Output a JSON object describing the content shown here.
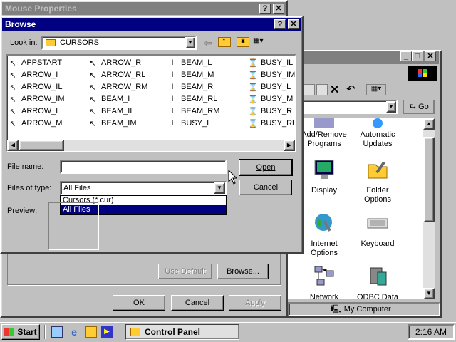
{
  "mouse_props": {
    "title": "Mouse Properties",
    "use_default_label": "Use Default",
    "browse_label": "Browse...",
    "ok_label": "OK",
    "cancel_label": "Cancel",
    "apply_label": "Apply"
  },
  "browse": {
    "title": "Browse",
    "look_in_label": "Look in:",
    "look_in_value": "CURSORS",
    "files": [
      [
        "APPSTART",
        "ARROW_I",
        "ARROW_IL",
        "ARROW_IM",
        "ARROW_L",
        "ARROW_M"
      ],
      [
        "ARROW_R",
        "ARROW_RL",
        "ARROW_RM",
        "BEAM_I",
        "BEAM_IL",
        "BEAM_IM"
      ],
      [
        "BEAM_L",
        "BEAM_M",
        "BEAM_R",
        "BEAM_RL",
        "BEAM_RM",
        "BUSY_I"
      ],
      [
        "BUSY_IL",
        "BUSY_IM",
        "BUSY_L",
        "BUSY_M",
        "BUSY_R",
        "BUSY_RL"
      ]
    ],
    "file_name_label": "File name:",
    "file_name_value": "",
    "files_of_type_label": "Files of type:",
    "files_of_type_value": "All Files",
    "type_options": [
      "Cursors (*.cur)",
      "All Files"
    ],
    "preview_label": "Preview:",
    "open_label": "Open",
    "cancel_label": "Cancel"
  },
  "control_panel": {
    "go_label": "Go",
    "items": [
      {
        "label": "Add/Remove Programs",
        "icon": "add-remove-programs-icon"
      },
      {
        "label": "Automatic Updates",
        "icon": "automatic-updates-icon"
      },
      {
        "label": "Display",
        "icon": "display-icon"
      },
      {
        "label": "Folder Options",
        "icon": "folder-options-icon"
      },
      {
        "label": "Internet Options",
        "icon": "internet-options-icon"
      },
      {
        "label": "Keyboard",
        "icon": "keyboard-icon"
      },
      {
        "label": "Network",
        "icon": "network-icon"
      },
      {
        "label": "ODBC Data",
        "icon": "odbc-data-icon"
      }
    ],
    "status": "My Computer"
  },
  "taskbar": {
    "start_label": "Start",
    "task_label": "Control Panel",
    "clock": "2:16 AM"
  }
}
